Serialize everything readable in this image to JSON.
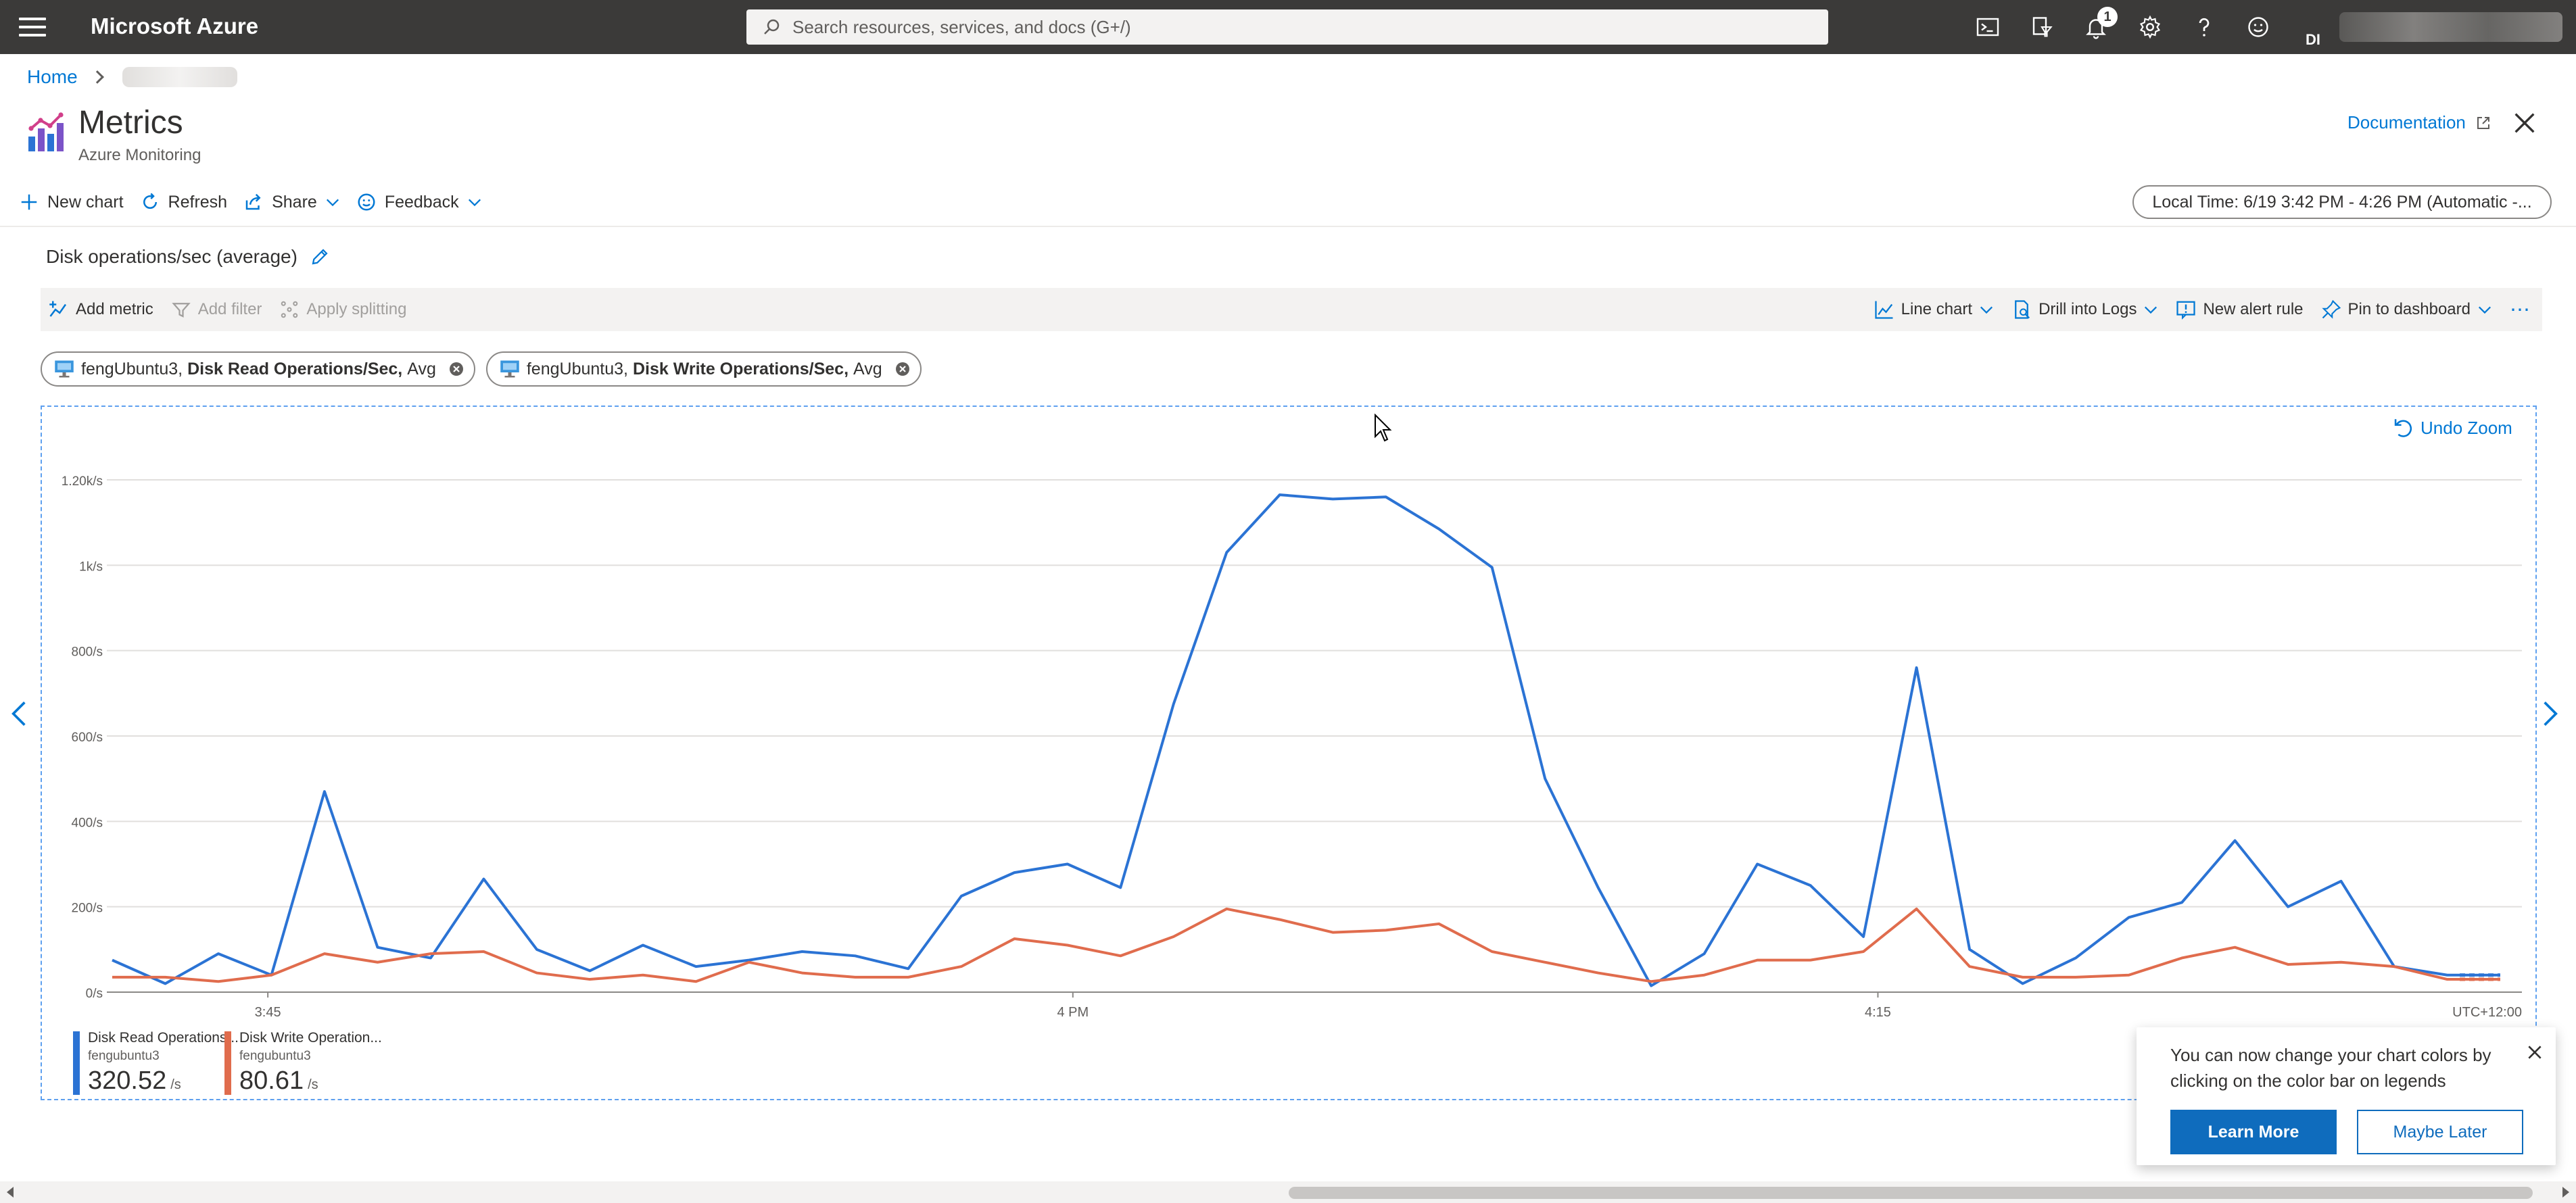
{
  "app": {
    "title": "Microsoft Azure",
    "search_placeholder": "Search resources, services, and docs (G+/)",
    "notification_count": "1",
    "account_initials": "DI"
  },
  "breadcrumb": {
    "home": "Home"
  },
  "header": {
    "title": "Metrics",
    "subtitle": "Azure Monitoring",
    "documentation": "Documentation"
  },
  "commands": {
    "new_chart": "New chart",
    "refresh": "Refresh",
    "share": "Share",
    "feedback": "Feedback",
    "time_range": "Local Time: 6/19 3:42 PM - 4:26 PM (Automatic -..."
  },
  "chart_panel": {
    "title": "Disk operations/sec (average)",
    "toolbar": {
      "add_metric": "Add metric",
      "add_filter": "Add filter",
      "apply_splitting": "Apply splitting",
      "line_chart": "Line chart",
      "drill_logs": "Drill into Logs",
      "new_alert": "New alert rule",
      "pin_dashboard": "Pin to dashboard"
    },
    "pills": [
      {
        "resource": "fengUbuntu3,",
        "metric": "Disk Read Operations/Sec,",
        "agg": "Avg"
      },
      {
        "resource": "fengUbuntu3,",
        "metric": "Disk Write Operations/Sec,",
        "agg": "Avg"
      }
    ],
    "undo_zoom": "Undo Zoom"
  },
  "chart_data": {
    "type": "line",
    "y_ticks": [
      "0/s",
      "200/s",
      "400/s",
      "600/s",
      "800/s",
      "1k/s",
      "1.20k/s"
    ],
    "ylim": [
      0,
      1200
    ],
    "x_ticks": [
      {
        "label": "3:45",
        "minute": 3
      },
      {
        "label": "4 PM",
        "minute": 18
      },
      {
        "label": "4:15",
        "minute": 33
      }
    ],
    "timezone_label": "UTC+12:00",
    "x_minutes": [
      0,
      1,
      2,
      3,
      4,
      5,
      6,
      7,
      8,
      9,
      10,
      11,
      12,
      13,
      14,
      15,
      16,
      17,
      18,
      19,
      20,
      21,
      22,
      23,
      24,
      25,
      26,
      27,
      28,
      29,
      30,
      31,
      32,
      33,
      34,
      35,
      36,
      37,
      38,
      39,
      40,
      41,
      42,
      43
    ],
    "series": [
      {
        "name": "Disk Read Operations...",
        "color": "#2b73d4",
        "values": [
          75,
          20,
          90,
          40,
          470,
          105,
          80,
          265,
          100,
          50,
          110,
          60,
          75,
          95,
          85,
          55,
          225,
          280,
          300,
          245,
          675,
          1030,
          1165,
          1155,
          1160,
          1085,
          995,
          500,
          245,
          15,
          90,
          300,
          250,
          130,
          760,
          100,
          20,
          80,
          175,
          210,
          355,
          200,
          260,
          60,
          40,
          40
        ]
      },
      {
        "name": "Disk Write Operation...",
        "color": "#e06c4d",
        "values": [
          35,
          35,
          25,
          40,
          90,
          70,
          90,
          95,
          45,
          30,
          40,
          25,
          70,
          45,
          35,
          35,
          60,
          125,
          110,
          85,
          130,
          195,
          170,
          140,
          145,
          160,
          95,
          70,
          45,
          25,
          40,
          75,
          75,
          95,
          195,
          60,
          35,
          35,
          40,
          80,
          105,
          65,
          70,
          60,
          30,
          30
        ]
      }
    ],
    "legend": [
      {
        "name": "Disk Read Operations...",
        "resource": "fengubuntu3",
        "value": "320.52",
        "unit": "/s",
        "color": "#2b73d4"
      },
      {
        "name": "Disk Write Operation...",
        "resource": "fengubuntu3",
        "value": "80.61",
        "unit": "/s",
        "color": "#e06c4d"
      }
    ]
  },
  "toast": {
    "message": "You can now change your chart colors by clicking on the color bar on legends",
    "learn_more": "Learn More",
    "maybe_later": "Maybe Later"
  }
}
